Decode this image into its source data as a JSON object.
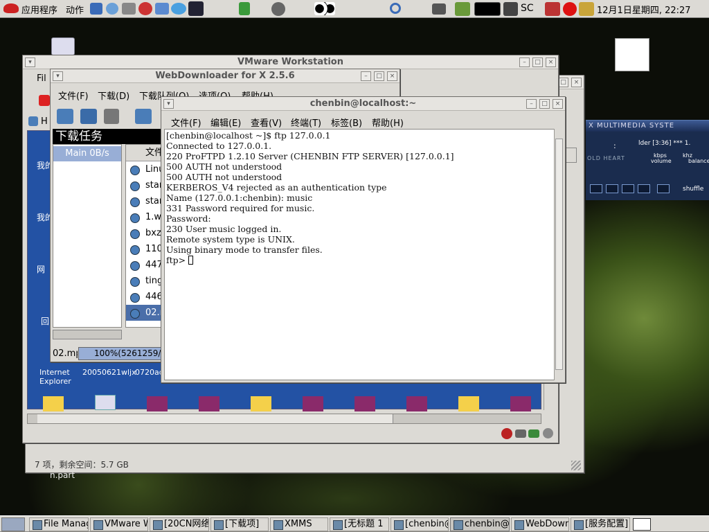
{
  "top_panel": {
    "menu_apps": "应用程序",
    "menu_actions": "动作",
    "sc_label": "SC",
    "clock": "12月1日星期四, 22:27"
  },
  "vmware": {
    "title": "VMware Workstation",
    "menu_partial": "Fil",
    "tab_partial": "H",
    "desk_labels": [
      "我的",
      "我的",
      "网",
      "回"
    ],
    "ie_label_1": "Internet",
    "ie_label_2": "Explorer",
    "file_label_1": "20050621wljx",
    "file_label_2": "0720ad",
    "status": "7 项，剩余空间：5.7 GB",
    "behind_label": "n.part"
  },
  "webdl": {
    "title": "WebDownloader for X 2.5.6",
    "menu": [
      "文件(F)",
      "下载(D)",
      "下载队列(Q)",
      "选项(O)",
      "帮助(H)"
    ],
    "tasks_heading": "下载任务",
    "queue_item": "Main  0B/s",
    "col_header": "文件",
    "files": [
      "Linu",
      "star",
      "star",
      "1.w",
      "bxz",
      "110",
      "447",
      "ting",
      "446",
      "02.m"
    ],
    "current_file": "02.mp",
    "progress_text": "100%(5261259/52",
    "progress": 1.0
  },
  "terminal": {
    "title": "chenbin@localhost:~",
    "menu": [
      "文件(F)",
      "编辑(E)",
      "查看(V)",
      "终端(T)",
      "标签(B)",
      "帮助(H)"
    ],
    "lines": [
      "[chenbin@localhost ~]$ ftp 127.0.0.1",
      "Connected to 127.0.0.1.",
      "220 ProFTPD 1.2.10 Server (CHENBIN FTP SERVER) [127.0.0.1]",
      "500 AUTH not understood",
      "500 AUTH not understood",
      "KERBEROS_V4 rejected as an authentication type",
      "Name (127.0.0.1:chenbin): music",
      "331 Password required for music.",
      "Password:",
      "230 User music logged in.",
      "Remote system type is UNIX.",
      "Using binary mode to transfer files."
    ],
    "prompt": "ftp> "
  },
  "xmms": {
    "title": "X MULTIMEDIA SYSTE",
    "track": "lder [3:36]  *** 1.",
    "time": ":",
    "kbps": "kbps",
    "khz": "khz",
    "volume": "volume",
    "balance": "balance",
    "shuffle": "shuffle",
    "brand": "OLD HEART"
  },
  "taskbar": [
    "File Manag",
    "VMware W",
    "[20CN网络",
    "[下载项]",
    "XMMS",
    "[无标题 1",
    "[chenbin@",
    "chenbin@l",
    "WebDownl",
    "[服务配置]"
  ]
}
